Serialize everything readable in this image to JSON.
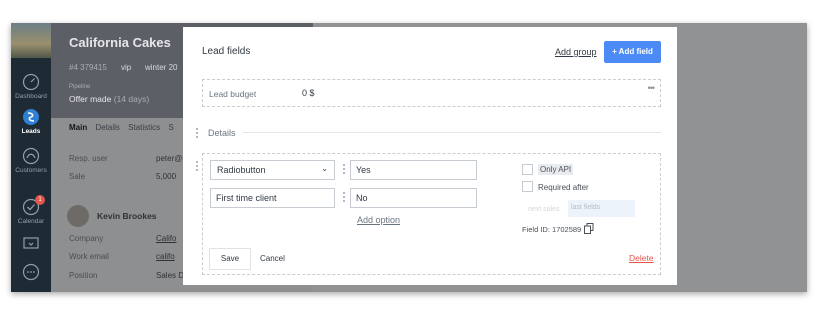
{
  "nav": {
    "items": [
      {
        "label": "Dashboard",
        "icon": "speedometer-icon"
      },
      {
        "label": "Leads",
        "icon": "leads-logo-icon"
      },
      {
        "label": "Customers",
        "icon": "customers-icon"
      },
      {
        "label": "Calendar",
        "icon": "calendar-check-icon",
        "badge": "1"
      },
      {
        "label": "",
        "icon": "monitor-icon"
      },
      {
        "label": "",
        "icon": "chat-icon"
      }
    ]
  },
  "background": {
    "title": "California Cakes",
    "meta_id": "#4 379415",
    "meta_vip": "vip",
    "meta_season": "winter 20",
    "pipeline_label": "Pipeline",
    "stage": "Offer made",
    "stage_days": "(14 days)",
    "tabs": [
      "Main",
      "Details",
      "Statistics",
      "S"
    ],
    "rows": [
      {
        "label": "Resp. user",
        "value": "peter@"
      },
      {
        "label": "Sale",
        "value": "5,000"
      }
    ],
    "contact_name": "Kevin Brookes",
    "contact_rows": [
      {
        "label": "Company",
        "value": "Califo"
      },
      {
        "label": "Work email",
        "value": "califo"
      },
      {
        "label": "Position",
        "value": "Sales D"
      }
    ]
  },
  "modal": {
    "title": "Lead fields",
    "add_group_label": "Add group",
    "add_field_label": "+ Add field",
    "budget": {
      "label": "Lead budget",
      "value": "0 $",
      "menu_glyph": "•••"
    },
    "details_label": "Details",
    "field_type": "Radiobutton",
    "field_name": "First time client",
    "options": [
      "Yes",
      "No"
    ],
    "add_option_label": "Add option",
    "only_api_label": "Only API",
    "required_after_label": "Required after",
    "next_sales_label": "next sales",
    "last_fields_label": "last fields",
    "field_id_label": "Field ID: 1702589",
    "save_label": "Save",
    "cancel_label": "Cancel",
    "delete_label": "Delete",
    "colors": {
      "accent": "#4c8bf5",
      "danger": "#e5534b"
    }
  }
}
